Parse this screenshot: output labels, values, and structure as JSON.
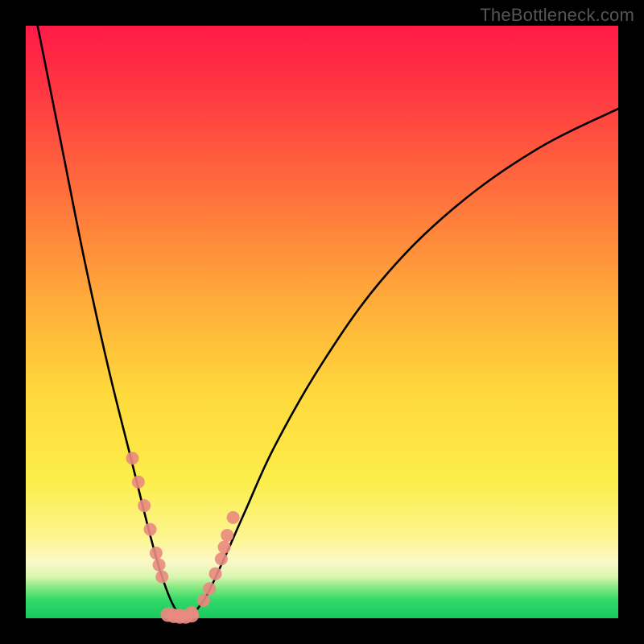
{
  "watermark": "TheBottleneck.com",
  "chart_data": {
    "type": "line",
    "title": "",
    "xlabel": "",
    "ylabel": "",
    "xlim": [
      0,
      100
    ],
    "ylim": [
      0,
      100
    ],
    "grid": false,
    "legend": false,
    "description": "Bottleneck curve over a vertical red→green gradient background. The black curve starts at the top-left, descends steeply to a minimum near x≈27 where y≈0 (the green 'ideal' zone), then rises again toward the right with decreasing slope. Salmon-colored dots mark sample points clustered on both inner flanks of the valley near the minimum.",
    "series": [
      {
        "name": "bottleneck-curve",
        "x": [
          2,
          6,
          10,
          14,
          18,
          21,
          23,
          25,
          27,
          30,
          33,
          37,
          42,
          50,
          60,
          72,
          86,
          100
        ],
        "y": [
          100,
          80,
          60,
          42,
          26,
          14,
          7,
          2,
          0,
          3,
          9,
          18,
          29,
          43,
          57,
          69,
          79,
          86
        ]
      }
    ],
    "points": {
      "name": "sample-dots",
      "color": "#e98a80",
      "x": [
        18,
        19,
        20,
        21,
        22,
        22.5,
        23,
        26,
        28,
        30,
        31,
        32,
        33,
        33.5,
        34,
        35
      ],
      "y": [
        27,
        23,
        19,
        15,
        11,
        9,
        7,
        0.5,
        1,
        3,
        5,
        7.5,
        10,
        12,
        14,
        17
      ]
    },
    "bottom_cluster": {
      "x": [
        24,
        25,
        26,
        27,
        28
      ],
      "y": [
        0.6,
        0.4,
        0.3,
        0.3,
        0.5
      ]
    }
  }
}
